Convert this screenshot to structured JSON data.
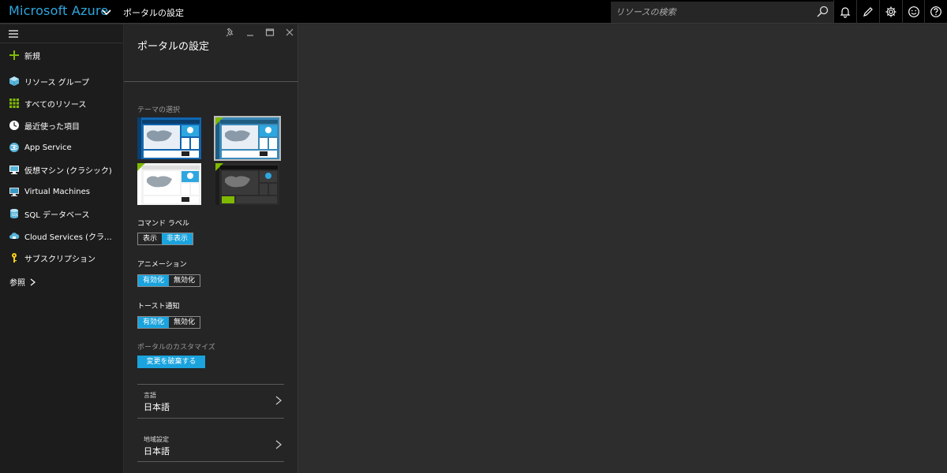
{
  "topbar": {
    "brand": "Microsoft Azure",
    "breadcrumb": "ポータルの設定",
    "search_placeholder": "リソースの検索"
  },
  "leftnav": {
    "new_label": "新規",
    "items": [
      {
        "label": "リソース グループ",
        "icon": "resource-group-icon"
      },
      {
        "label": "すべてのリソース",
        "icon": "all-resources-icon"
      },
      {
        "label": "最近使った項目",
        "icon": "clock-icon"
      },
      {
        "label": "App Service",
        "icon": "app-service-icon"
      },
      {
        "label": "仮想マシン (クラシック)",
        "icon": "vm-classic-icon"
      },
      {
        "label": "Virtual Machines",
        "icon": "vm-icon"
      },
      {
        "label": "SQL データベース",
        "icon": "sql-database-icon"
      },
      {
        "label": "Cloud Services (クラシック)",
        "icon": "cloud-services-icon"
      },
      {
        "label": "サブスクリプション",
        "icon": "key-icon"
      }
    ],
    "more_label": "参照"
  },
  "blade": {
    "title": "ポータルの設定",
    "theme_label": "テーマの選択",
    "command_label": "コマンド ラベル",
    "command_show": "表示",
    "command_hide": "非表示",
    "animation_label": "アニメーション",
    "animation_on": "有効化",
    "animation_off": "無効化",
    "toast_label": "トースト通知",
    "toast_on": "有効化",
    "toast_off": "無効化",
    "customize_label": "ポータルのカスタマイズ",
    "discard_button": "変更を破棄する",
    "language_label": "言語",
    "language_value": "日本語",
    "region_label": "地域設定",
    "region_value": "日本語"
  },
  "colors": {
    "accent": "#1aa3dd",
    "brand": "#2ea7e0",
    "topbar_bg": "#000000",
    "nav_bg": "#1c1c1c",
    "blade_bg": "#252526"
  }
}
